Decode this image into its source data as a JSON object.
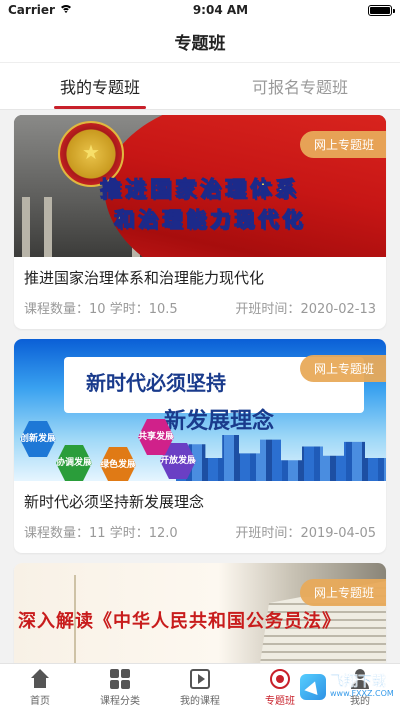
{
  "status_bar": {
    "carrier": "Carrier",
    "time": "9:04 AM",
    "battery_level": 1.0
  },
  "nav": {
    "title": "专题班"
  },
  "tabs": [
    {
      "label": "我的专题班",
      "active": true
    },
    {
      "label": "可报名专题班",
      "active": false
    }
  ],
  "courses": [
    {
      "badge": "网上专题班",
      "cover_text": [
        "推进国家治理体系",
        "和治理能力现代化"
      ],
      "title": "推进国家治理体系和治理能力现代化",
      "count_label": "课程数量：",
      "count": "10",
      "hours_label": "学时：",
      "hours": "10.5",
      "start_label": "开班时间：",
      "start_date": "2020-02-13"
    },
    {
      "badge": "网上专题班",
      "cover_text": [
        "新时代必须坚持",
        "新发展理念"
      ],
      "cover_hex": [
        "创新发展",
        "协调发展",
        "绿色发展",
        "开放发展",
        "共享发展"
      ],
      "title": "新时代必须坚持新发展理念",
      "count_label": "课程数量：",
      "count": "11",
      "hours_label": "学时：",
      "hours": "12.0",
      "start_label": "开班时间：",
      "start_date": "2019-04-05"
    },
    {
      "badge": "网上专题班",
      "cover_text": [
        "深入解读《中华人民共和国公务员法》"
      ]
    }
  ],
  "tabbar": [
    {
      "label": "首页",
      "icon": "home-icon",
      "active": false
    },
    {
      "label": "课程分类",
      "icon": "grid-icon",
      "active": false
    },
    {
      "label": "我的课程",
      "icon": "play-icon",
      "active": false
    },
    {
      "label": "专题班",
      "icon": "special-class-icon",
      "active": true
    },
    {
      "label": "我的",
      "icon": "user-icon",
      "active": false
    }
  ],
  "watermark": {
    "brand": "飞翔下载",
    "url": "www.FXXZ.COM"
  },
  "colors": {
    "accent": "#c8202a",
    "badge": "#e8aa5a"
  }
}
